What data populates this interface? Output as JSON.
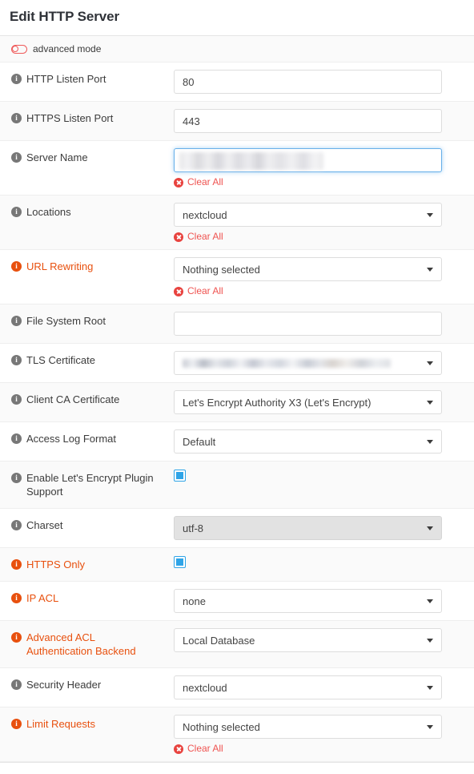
{
  "header": {
    "title": "Edit HTTP Server"
  },
  "advanced": {
    "label": "advanced mode",
    "icon": "toggle-off-icon",
    "enabled": false,
    "accent_color": "#ef5a5a"
  },
  "common": {
    "info_icon": "info-circle-icon",
    "warn_info_icon": "info-circle-warning-icon",
    "clear_all_label": "Clear All",
    "clear_icon": "times-circle-icon",
    "caret_icon": "chevron-down-icon",
    "nothing_selected": "Nothing selected",
    "colors": {
      "warn_label": "#e8500e",
      "clear_link": "#ef5350",
      "checkbox_accent": "#2fa4e7",
      "focus_border": "#66afe9"
    }
  },
  "rows": [
    {
      "key": "http-listen-port",
      "label": "HTTP Listen Port",
      "warn": false,
      "control": "text",
      "value": "80",
      "clear_all": false
    },
    {
      "key": "https-listen-port",
      "label": "HTTPS Listen Port",
      "warn": false,
      "control": "text",
      "value": "443",
      "clear_all": false
    },
    {
      "key": "server-name",
      "label": "Server Name",
      "warn": false,
      "control": "tokenfield",
      "value": "",
      "redacted": true,
      "focused": true,
      "clear_all": true
    },
    {
      "key": "locations",
      "label": "Locations",
      "warn": false,
      "control": "select",
      "value": "nextcloud",
      "clear_all": true
    },
    {
      "key": "url-rewriting",
      "label": "URL Rewriting",
      "warn": true,
      "control": "select",
      "value": "Nothing selected",
      "clear_all": true
    },
    {
      "key": "file-system-root",
      "label": "File System Root",
      "warn": false,
      "control": "text",
      "value": "",
      "clear_all": false
    },
    {
      "key": "tls-certificate",
      "label": "TLS Certificate",
      "warn": false,
      "control": "select",
      "value": "",
      "redacted": true,
      "clear_all": false
    },
    {
      "key": "client-ca-certificate",
      "label": "Client CA Certificate",
      "warn": false,
      "control": "select",
      "value": "Let's Encrypt Authority X3 (Let's Encrypt)",
      "clear_all": false
    },
    {
      "key": "access-log-format",
      "label": "Access Log Format",
      "warn": false,
      "control": "select",
      "value": "Default",
      "clear_all": false
    },
    {
      "key": "enable-lets-encrypt-plugin-support",
      "label": "Enable Let's Encrypt Plugin Support",
      "warn": false,
      "control": "checkbox",
      "checked": true,
      "clear_all": false
    },
    {
      "key": "charset",
      "label": "Charset",
      "warn": false,
      "control": "select",
      "value": "utf-8",
      "disabled": true,
      "clear_all": false
    },
    {
      "key": "https-only",
      "label": "HTTPS Only",
      "warn": true,
      "control": "checkbox",
      "checked": true,
      "clear_all": false
    },
    {
      "key": "ip-acl",
      "label": "IP ACL",
      "warn": true,
      "control": "select",
      "value": "none",
      "clear_all": false
    },
    {
      "key": "advanced-acl-authentication-backend",
      "label": "Advanced ACL Authentication Backend",
      "warn": true,
      "control": "select",
      "value": "Local Database",
      "clear_all": false
    },
    {
      "key": "security-header",
      "label": "Security Header",
      "warn": false,
      "control": "select",
      "value": "nextcloud",
      "clear_all": false
    },
    {
      "key": "limit-requests",
      "label": "Limit Requests",
      "warn": true,
      "control": "select",
      "value": "Nothing selected",
      "clear_all": true
    }
  ]
}
